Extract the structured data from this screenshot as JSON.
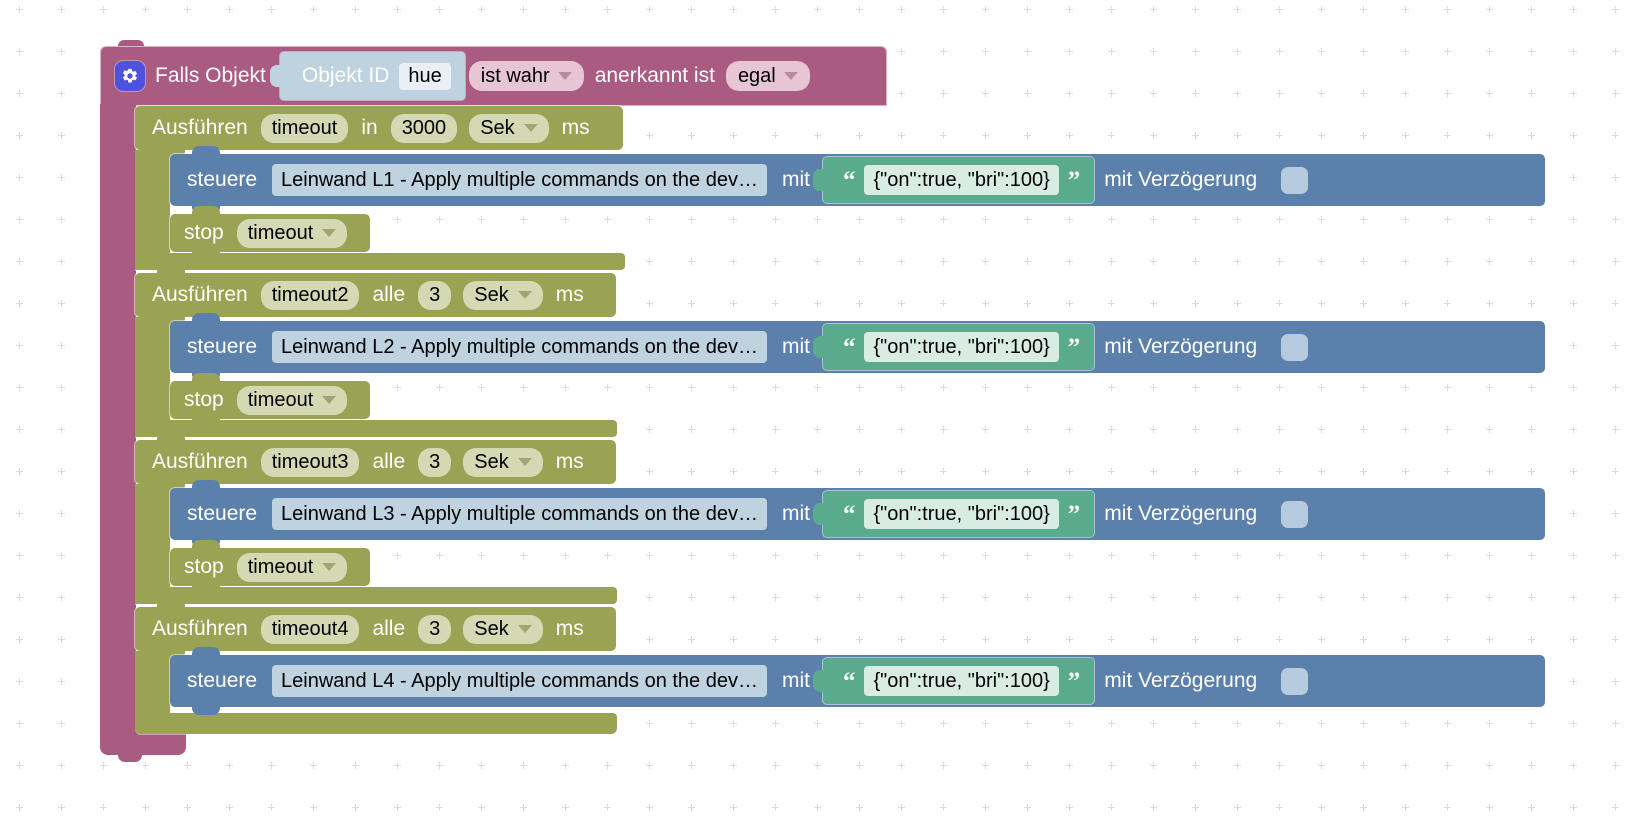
{
  "workspace": {
    "background_color": "#ffffff",
    "grid_dot_color": "#dcdcdc",
    "grid_spacing": 42
  },
  "colors": {
    "control_pink": "#a95b81",
    "timer_olive": "#9aa353",
    "action_blue": "#5b80ab",
    "text_green": "#5aab8d",
    "gear_blue": "#4f52de",
    "field_light_blue": "#bed2e0",
    "field_light_olive": "#d4d9b4",
    "field_pink_pill": "#e7c5d5",
    "checkbox_fill": "#b6cade"
  },
  "if_block": {
    "gear_icon": "gear-icon",
    "label": "Falls Objekt",
    "object_value": {
      "label": "Objekt ID",
      "field_value": "hue"
    },
    "condition_dropdown": "ist wahr",
    "middle_label": "anerkannt ist",
    "ack_dropdown": "egal"
  },
  "timers": [
    {
      "keyword": "Ausführen",
      "name": "timeout",
      "connector": "in",
      "interval": "3000",
      "unit_dropdown": "Sek",
      "unit_suffix": "ms",
      "action": {
        "keyword": "steuere",
        "target": "Leinwand L1 - Apply multiple commands on the dev…",
        "with_label": "mit",
        "json_value": "{\"on\":true, \"bri\":100}",
        "quote_open": "“",
        "quote_close": "”",
        "delay_label": "mit Verzögerung",
        "delay_checked": false
      },
      "stop": {
        "keyword": "stop",
        "target_dropdown": "timeout"
      }
    },
    {
      "keyword": "Ausführen",
      "name": "timeout2",
      "connector": "alle",
      "interval": "3",
      "unit_dropdown": "Sek",
      "unit_suffix": "ms",
      "action": {
        "keyword": "steuere",
        "target": "Leinwand L2 - Apply multiple commands on the dev…",
        "with_label": "mit",
        "json_value": "{\"on\":true, \"bri\":100}",
        "quote_open": "“",
        "quote_close": "”",
        "delay_label": "mit Verzögerung",
        "delay_checked": false
      },
      "stop": {
        "keyword": "stop",
        "target_dropdown": "timeout"
      }
    },
    {
      "keyword": "Ausführen",
      "name": "timeout3",
      "connector": "alle",
      "interval": "3",
      "unit_dropdown": "Sek",
      "unit_suffix": "ms",
      "action": {
        "keyword": "steuere",
        "target": "Leinwand L3 - Apply multiple commands on the dev…",
        "with_label": "mit",
        "json_value": "{\"on\":true, \"bri\":100}",
        "quote_open": "“",
        "quote_close": "”",
        "delay_label": "mit Verzögerung",
        "delay_checked": false
      },
      "stop": {
        "keyword": "stop",
        "target_dropdown": "timeout"
      }
    },
    {
      "keyword": "Ausführen",
      "name": "timeout4",
      "connector": "alle",
      "interval": "3",
      "unit_dropdown": "Sek",
      "unit_suffix": "ms",
      "action": {
        "keyword": "steuere",
        "target": "Leinwand L4 - Apply multiple commands on the dev…",
        "with_label": "mit",
        "json_value": "{\"on\":true, \"bri\":100}",
        "quote_open": "“",
        "quote_close": "”",
        "delay_label": "mit Verzögerung",
        "delay_checked": false
      },
      "stop": null
    }
  ]
}
